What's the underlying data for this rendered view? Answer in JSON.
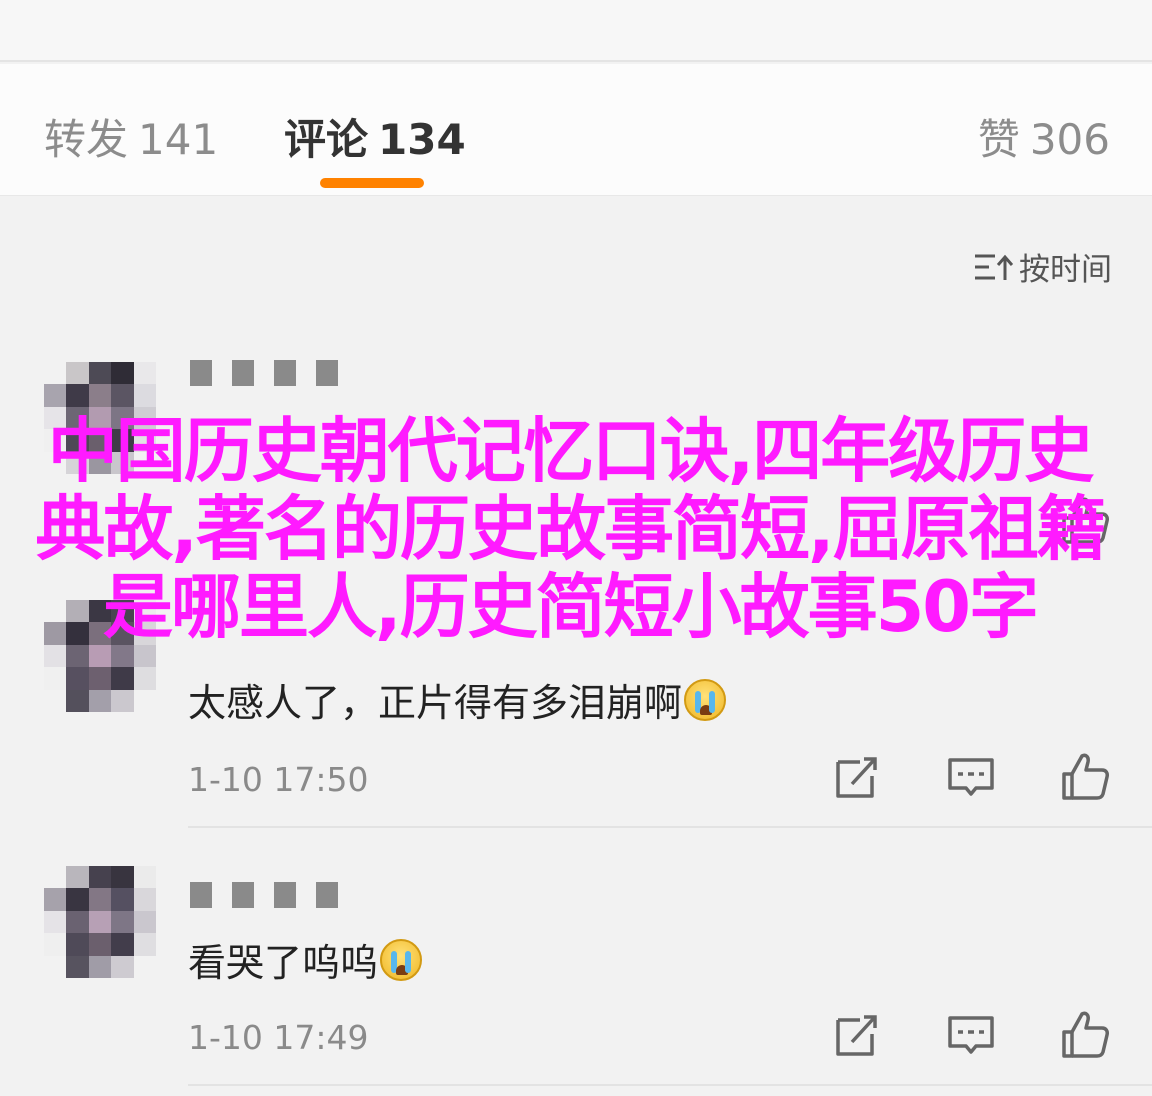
{
  "tabs": [
    {
      "label": "转发",
      "count": "141",
      "active": false
    },
    {
      "label": "评论",
      "count": "134",
      "active": true
    },
    {
      "label": "赞",
      "count": "306",
      "active": false
    }
  ],
  "sort": {
    "label": "按时间",
    "icon": "sort-icon"
  },
  "comments": [
    {
      "text": "",
      "time": "",
      "emoji": "crying-face"
    },
    {
      "text": "太感人了，正片得有多泪崩啊",
      "time": "1-10 17:50",
      "emoji": "crying-face"
    },
    {
      "text": "看哭了呜呜",
      "time": "1-10 17:49",
      "emoji": "crying-face"
    }
  ],
  "overlay": {
    "title": "中国历史朝代记忆口诀,四年级历史典故,著名的历史故事简短,屈原祖籍是哪里人,历史简短小故事50字"
  },
  "colors": {
    "accent": "#ff8200",
    "overlay": "#ff1aff"
  }
}
